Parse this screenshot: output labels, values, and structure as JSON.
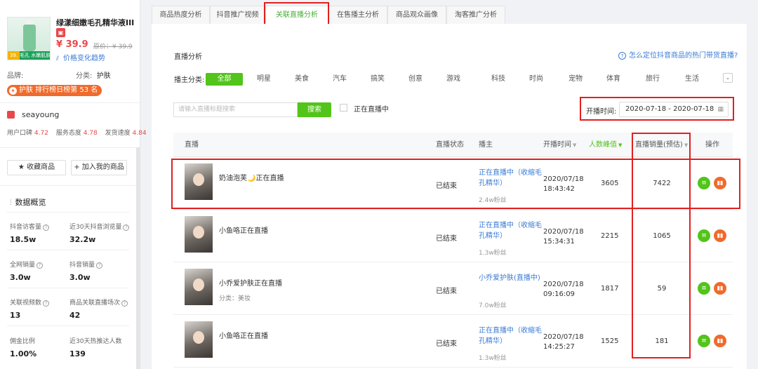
{
  "product": {
    "name": "绿漾细嫩毛孔精华液III",
    "image_strip_text": "细嫩毛孔 水嫩肌肤",
    "image_price_tag": "39.",
    "price": "¥ 39.9",
    "original_price": "原价：¥ 39.9",
    "trend_link": "价格变化趋势",
    "brand_label": "品牌:",
    "category_label": "分类:",
    "category_value": "护肤",
    "rank_text": "护肤 排行榜日榜第 53 名"
  },
  "shop": {
    "name": "seayoung",
    "scores": [
      {
        "label": "用户口碑",
        "value": "4.72"
      },
      {
        "label": "服务态度",
        "value": "4.78"
      },
      {
        "label": "发货速度",
        "value": "4.84"
      }
    ],
    "fav_button": "★ 收藏商品",
    "add_button": "+ 加入我的商品"
  },
  "overview": {
    "title": "数据概览",
    "stats": [
      {
        "label": "抖音访客量",
        "value": "18.5w",
        "help": true
      },
      {
        "label": "近30天抖音浏览量",
        "value": "32.2w",
        "help": true
      },
      {
        "label": "全网销量",
        "value": "3.0w",
        "help": true
      },
      {
        "label": "抖音销量",
        "value": "3.0w",
        "help": true
      },
      {
        "label": "关联视频数",
        "value": "13",
        "help": true
      },
      {
        "label": "商品关联直播场次",
        "value": "42",
        "help": true
      },
      {
        "label": "佣金比例",
        "value": "1.00%",
        "help": false
      },
      {
        "label": "近30天热推达人数",
        "value": "139",
        "help": false
      }
    ]
  },
  "tabs": [
    {
      "label": "商品热度分析",
      "active": false
    },
    {
      "label": "抖音推广视频",
      "active": false
    },
    {
      "label": "关联直播分析",
      "active": true
    },
    {
      "label": "在售播主分析",
      "active": false
    },
    {
      "label": "商品观众画像",
      "active": false
    },
    {
      "label": "淘客推广分析",
      "active": false
    }
  ],
  "section": {
    "title": "直播分析",
    "help_link": "怎么定位抖音商品的热门带货直播?",
    "category_label": "播主分类:",
    "categories": [
      "全部",
      "明星",
      "美食",
      "汽车",
      "搞笑",
      "创意",
      "游戏",
      "科技",
      "时尚",
      "宠物",
      "体育",
      "旅行",
      "生活"
    ],
    "active_category": "全部",
    "search_placeholder": "请输入直播标题搜索",
    "search_button": "搜索",
    "live_checkbox_label": "正在直播中",
    "date_label": "开播时间:",
    "date_range": "2020-07-18 - 2020-07-18"
  },
  "table": {
    "columns": [
      "直播",
      "直播状态",
      "播主",
      "开播时间",
      "人数峰值",
      "直播销量(预估)",
      "操作"
    ],
    "rows": [
      {
        "title": "奶油泡芙🌙正在直播",
        "subtitle": "",
        "status": "已结束",
        "anchor": "正在直播中（收缩毛孔精华）",
        "fans": "2.4w粉丝",
        "date": "2020/07/18",
        "time": "18:43:42",
        "peak": "3605",
        "sales": "7422"
      },
      {
        "title": "小鱼咯正在直播",
        "subtitle": "",
        "status": "已结束",
        "anchor": "正在直播中（收缩毛孔精华）",
        "fans": "1.3w粉丝",
        "date": "2020/07/18",
        "time": "15:34:31",
        "peak": "2215",
        "sales": "1065"
      },
      {
        "title": "小乔爱护肤正在直播",
        "subtitle": "分类：美妆",
        "status": "已结束",
        "anchor": "小乔爱护肤(直播中)",
        "fans": "7.0w粉丝",
        "date": "2020/07/18",
        "time": "09:16:09",
        "peak": "1817",
        "sales": "59"
      },
      {
        "title": "小鱼咯正在直播",
        "subtitle": "",
        "status": "已结束",
        "anchor": "正在直播中（收缩毛孔精华）",
        "fans": "1.3w粉丝",
        "date": "2020/07/18",
        "time": "14:25:27",
        "peak": "1525",
        "sales": "181"
      }
    ]
  },
  "colors": {
    "accent_green": "#52c41a",
    "link_blue": "#3a7bd5",
    "highlight_red": "#e02020",
    "price_red": "#e8484b",
    "orange": "#f06a2b"
  }
}
